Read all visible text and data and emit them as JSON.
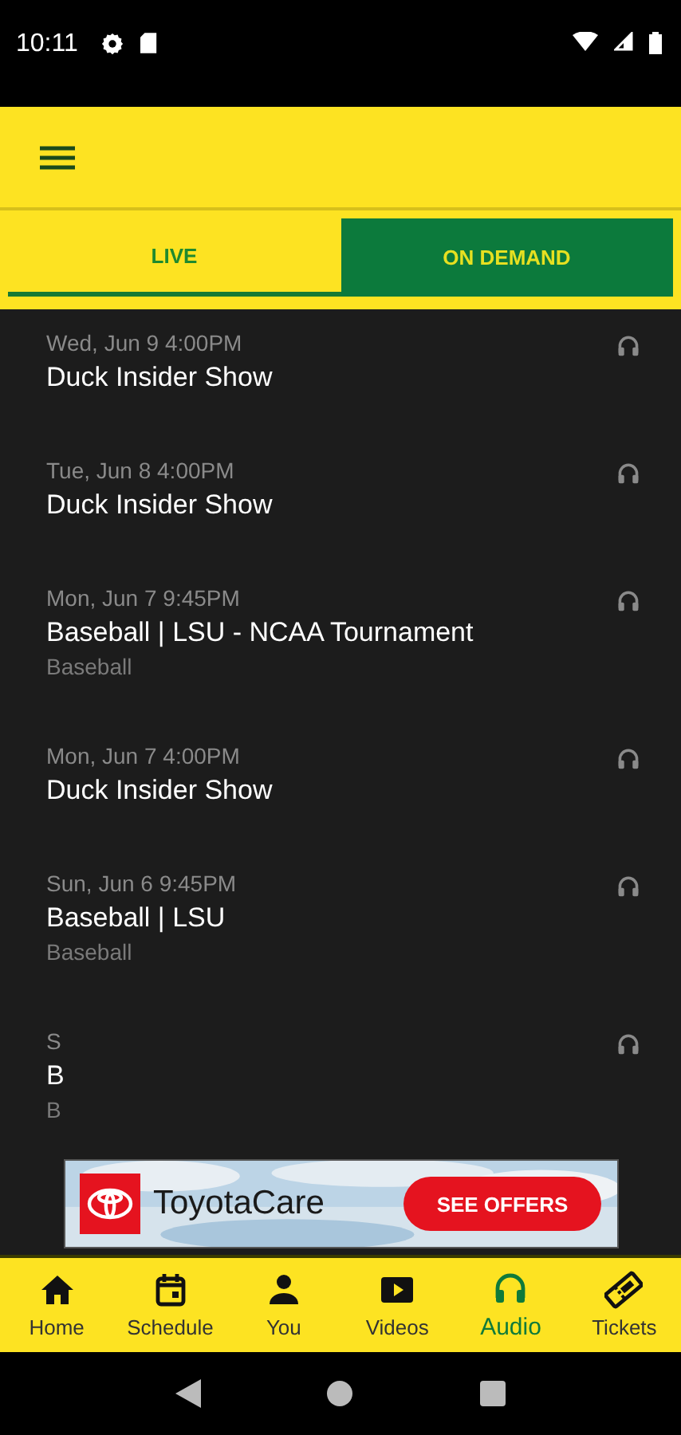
{
  "status_bar": {
    "time": "10:11"
  },
  "tabs": [
    {
      "label": "LIVE",
      "selected": false
    },
    {
      "label": "ON DEMAND",
      "selected": true
    }
  ],
  "episodes": [
    {
      "date": "Wed, Jun 9 4:00PM",
      "title": "Duck Insider Show"
    },
    {
      "date": "Tue, Jun 8 4:00PM",
      "title": "Duck Insider Show"
    },
    {
      "date": "Mon, Jun 7 9:45PM",
      "title": "Baseball | LSU - NCAA Tournament",
      "subtitle": "Baseball"
    },
    {
      "date": "Mon, Jun 7 4:00PM",
      "title": "Duck Insider Show"
    },
    {
      "date": "Sun, Jun 6 9:45PM",
      "title": "Baseball | LSU",
      "subtitle": "Baseball"
    },
    {
      "date": "S",
      "title": "B",
      "subtitle": "B"
    }
  ],
  "ad": {
    "brand": "ToyotaCare",
    "button": "SEE OFFERS"
  },
  "bottom_nav": [
    {
      "kind": "home",
      "label": "Home",
      "selected": false
    },
    {
      "kind": "calendar",
      "label": "Schedule",
      "selected": false
    },
    {
      "kind": "person",
      "label": "You",
      "selected": false
    },
    {
      "kind": "video",
      "label": "Videos",
      "selected": false
    },
    {
      "kind": "headphones",
      "label": "Audio",
      "selected": true
    },
    {
      "kind": "ticket",
      "label": "Tickets",
      "selected": false
    }
  ]
}
